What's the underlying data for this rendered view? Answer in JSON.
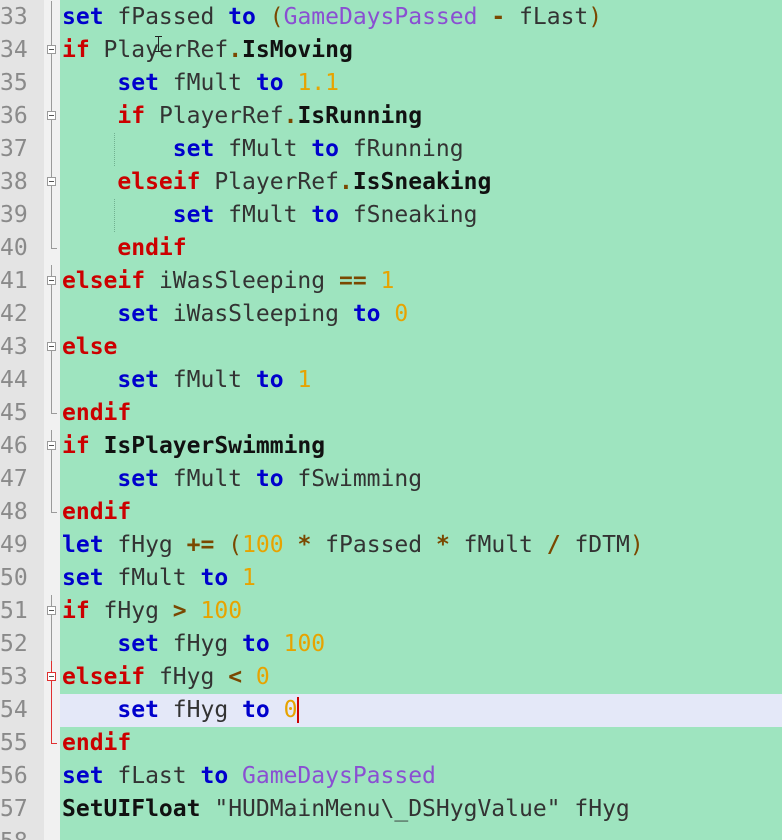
{
  "editor": {
    "background_color": "#9ee4bf",
    "current_line_number": 54,
    "lines": [
      {
        "num": "33",
        "indent": 0,
        "fold": "line",
        "tokens": [
          [
            "kw-blue",
            "set"
          ],
          [
            "ident",
            " fPassed "
          ],
          [
            "kw-blue",
            "to"
          ],
          [
            "ident",
            " "
          ],
          [
            "paren",
            "("
          ],
          [
            "purple",
            "GameDaysPassed"
          ],
          [
            "ident",
            " "
          ],
          [
            "op",
            "-"
          ],
          [
            "ident",
            " fLast"
          ],
          [
            "paren",
            ")"
          ]
        ]
      },
      {
        "num": "34",
        "indent": 0,
        "fold": "box",
        "tokens": [
          [
            "kw-red",
            "if"
          ],
          [
            "ident",
            " PlayerRef"
          ],
          [
            "op",
            "."
          ],
          [
            "func",
            "IsMoving"
          ]
        ]
      },
      {
        "num": "35",
        "indent": 1,
        "fold": "line",
        "tokens": [
          [
            "kw-blue",
            "set"
          ],
          [
            "ident",
            " fMult "
          ],
          [
            "kw-blue",
            "to"
          ],
          [
            "ident",
            " "
          ],
          [
            "num",
            "1.1"
          ]
        ]
      },
      {
        "num": "36",
        "indent": 1,
        "fold": "box",
        "tokens": [
          [
            "kw-red",
            "if"
          ],
          [
            "ident",
            " PlayerRef"
          ],
          [
            "op",
            "."
          ],
          [
            "func",
            "IsRunning"
          ]
        ]
      },
      {
        "num": "37",
        "indent": 2,
        "fold": "line",
        "tokens": [
          [
            "kw-blue",
            "set"
          ],
          [
            "ident",
            " fMult "
          ],
          [
            "kw-blue",
            "to"
          ],
          [
            "ident",
            " fRunning"
          ]
        ]
      },
      {
        "num": "38",
        "indent": 1,
        "fold": "box",
        "tokens": [
          [
            "kw-red",
            "elseif"
          ],
          [
            "ident",
            " PlayerRef"
          ],
          [
            "op",
            "."
          ],
          [
            "func",
            "IsSneaking"
          ]
        ]
      },
      {
        "num": "39",
        "indent": 2,
        "fold": "line",
        "tokens": [
          [
            "kw-blue",
            "set"
          ],
          [
            "ident",
            " fMult "
          ],
          [
            "kw-blue",
            "to"
          ],
          [
            "ident",
            " fSneaking"
          ]
        ]
      },
      {
        "num": "40",
        "indent": 1,
        "fold": "end",
        "tokens": [
          [
            "kw-red",
            "endif"
          ]
        ]
      },
      {
        "num": "41",
        "indent": 0,
        "fold": "box",
        "tokens": [
          [
            "kw-red",
            "elseif"
          ],
          [
            "ident",
            " iWasSleeping "
          ],
          [
            "op",
            "=="
          ],
          [
            "ident",
            " "
          ],
          [
            "num",
            "1"
          ]
        ]
      },
      {
        "num": "42",
        "indent": 1,
        "fold": "line",
        "tokens": [
          [
            "kw-blue",
            "set"
          ],
          [
            "ident",
            " iWasSleeping "
          ],
          [
            "kw-blue",
            "to"
          ],
          [
            "ident",
            " "
          ],
          [
            "num",
            "0"
          ]
        ]
      },
      {
        "num": "43",
        "indent": 0,
        "fold": "box",
        "tokens": [
          [
            "kw-red",
            "else"
          ]
        ]
      },
      {
        "num": "44",
        "indent": 1,
        "fold": "line",
        "tokens": [
          [
            "kw-blue",
            "set"
          ],
          [
            "ident",
            " fMult "
          ],
          [
            "kw-blue",
            "to"
          ],
          [
            "ident",
            " "
          ],
          [
            "num",
            "1"
          ]
        ]
      },
      {
        "num": "45",
        "indent": 0,
        "fold": "end",
        "tokens": [
          [
            "kw-red",
            "endif"
          ]
        ]
      },
      {
        "num": "46",
        "indent": 0,
        "fold": "box",
        "tokens": [
          [
            "kw-red",
            "if"
          ],
          [
            "ident",
            " "
          ],
          [
            "func",
            "IsPlayerSwimming"
          ]
        ]
      },
      {
        "num": "47",
        "indent": 1,
        "fold": "line",
        "tokens": [
          [
            "kw-blue",
            "set"
          ],
          [
            "ident",
            " fMult "
          ],
          [
            "kw-blue",
            "to"
          ],
          [
            "ident",
            " fSwimming"
          ]
        ]
      },
      {
        "num": "48",
        "indent": 0,
        "fold": "end",
        "tokens": [
          [
            "kw-red",
            "endif"
          ]
        ]
      },
      {
        "num": "49",
        "indent": 0,
        "fold": "none",
        "tokens": [
          [
            "kw-blue",
            "let"
          ],
          [
            "ident",
            " fHyg "
          ],
          [
            "op",
            "+="
          ],
          [
            "ident",
            " "
          ],
          [
            "paren",
            "("
          ],
          [
            "num",
            "100"
          ],
          [
            "ident",
            " "
          ],
          [
            "op",
            "*"
          ],
          [
            "ident",
            " fPassed "
          ],
          [
            "op",
            "*"
          ],
          [
            "ident",
            " fMult "
          ],
          [
            "op",
            "/"
          ],
          [
            "ident",
            " fDTM"
          ],
          [
            "paren",
            ")"
          ]
        ]
      },
      {
        "num": "50",
        "indent": 0,
        "fold": "none",
        "tokens": [
          [
            "kw-blue",
            "set"
          ],
          [
            "ident",
            " fMult "
          ],
          [
            "kw-blue",
            "to"
          ],
          [
            "ident",
            " "
          ],
          [
            "num",
            "1"
          ]
        ]
      },
      {
        "num": "51",
        "indent": 0,
        "fold": "box",
        "tokens": [
          [
            "kw-red",
            "if"
          ],
          [
            "ident",
            " fHyg "
          ],
          [
            "op",
            ">"
          ],
          [
            "ident",
            " "
          ],
          [
            "num",
            "100"
          ]
        ]
      },
      {
        "num": "52",
        "indent": 1,
        "fold": "line",
        "tokens": [
          [
            "kw-blue",
            "set"
          ],
          [
            "ident",
            " fHyg "
          ],
          [
            "kw-blue",
            "to"
          ],
          [
            "ident",
            " "
          ],
          [
            "num",
            "100"
          ]
        ]
      },
      {
        "num": "53",
        "indent": 0,
        "fold": "box-red",
        "tokens": [
          [
            "kw-red",
            "elseif"
          ],
          [
            "ident",
            " fHyg "
          ],
          [
            "op",
            "<"
          ],
          [
            "ident",
            " "
          ],
          [
            "num",
            "0"
          ]
        ]
      },
      {
        "num": "54",
        "indent": 1,
        "fold": "line-red",
        "tokens": [
          [
            "kw-blue",
            "set"
          ],
          [
            "ident",
            " fHyg "
          ],
          [
            "kw-blue",
            "to"
          ],
          [
            "ident",
            " "
          ],
          [
            "num",
            "0"
          ]
        ]
      },
      {
        "num": "55",
        "indent": 0,
        "fold": "end-red",
        "tokens": [
          [
            "kw-red",
            "endif"
          ]
        ]
      },
      {
        "num": "56",
        "indent": 0,
        "fold": "none",
        "tokens": [
          [
            "kw-blue",
            "set"
          ],
          [
            "ident",
            " fLast "
          ],
          [
            "kw-blue",
            "to"
          ],
          [
            "ident",
            " "
          ],
          [
            "purple",
            "GameDaysPassed"
          ]
        ]
      },
      {
        "num": "57",
        "indent": 0,
        "fold": "none",
        "tokens": [
          [
            "func",
            "SetUIFloat"
          ],
          [
            "ident",
            " "
          ],
          [
            "str",
            "\"HUDMainMenu\\_DSHygValue\""
          ],
          [
            "ident",
            " fHyg"
          ]
        ]
      },
      {
        "num": "58",
        "indent": 0,
        "fold": "none",
        "tokens": []
      }
    ]
  }
}
